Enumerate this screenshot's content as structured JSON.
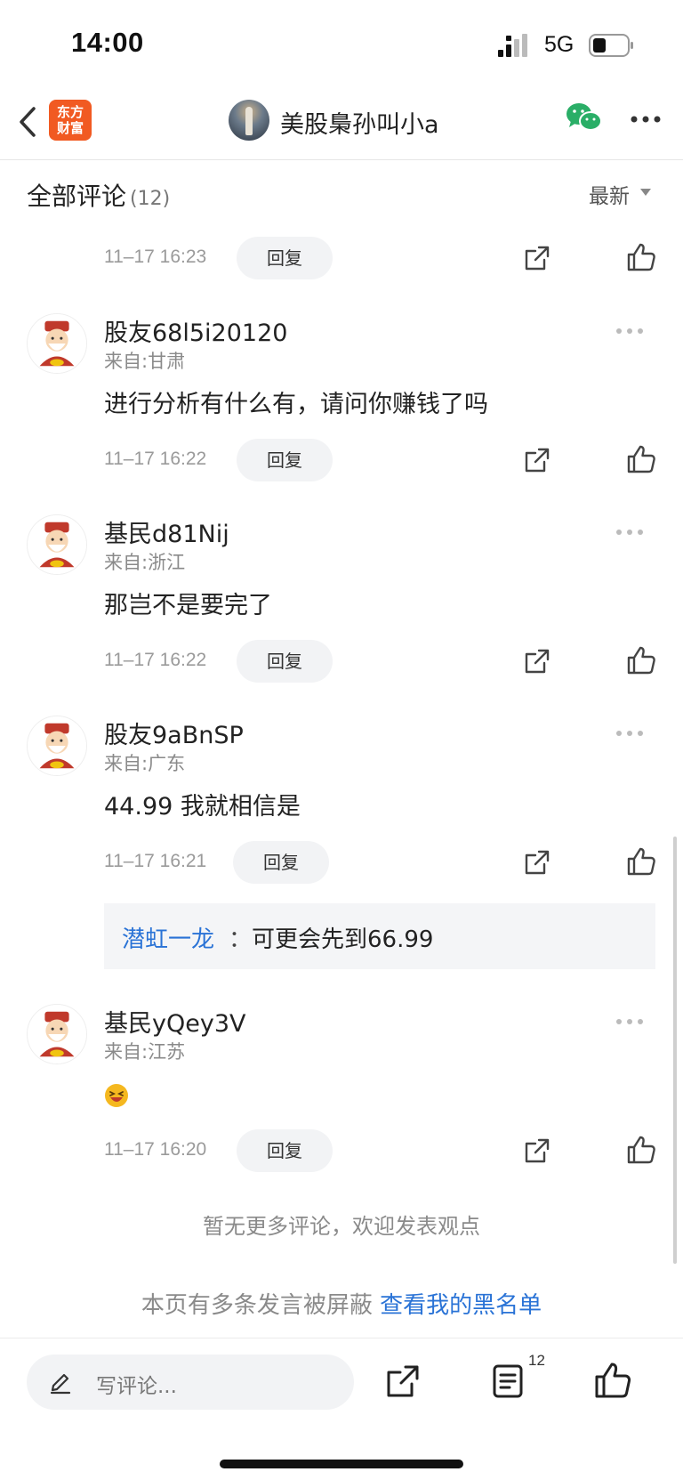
{
  "status_bar": {
    "time": "14:00",
    "network": "5G"
  },
  "nav": {
    "logo_line1": "东方",
    "logo_line2": "财富",
    "author": "美股梟孙叫小a"
  },
  "comments_header": {
    "title": "全部评论",
    "count": "(12)",
    "sort": "最新"
  },
  "comments": [
    {
      "timestamp": "11–17 16:23",
      "reply": "回复"
    },
    {
      "username": "股友68l5i20120",
      "location": "来自:甘肃",
      "text": "进行分析有什么有，请问你赚钱了吗",
      "timestamp": "11–17 16:22",
      "reply": "回复"
    },
    {
      "username": "基民d81Nij",
      "location": "来自:浙江",
      "text": "那岂不是要完了",
      "timestamp": "11–17 16:22",
      "reply": "回复"
    },
    {
      "username": "股友9aBnSP",
      "location": "来自:广东",
      "text": "44.99 我就相信是",
      "timestamp": "11–17 16:21",
      "reply": "回复",
      "sub_reply": {
        "user": "潜虹一龙",
        "colon": "：",
        "text": "可更会先到66.99"
      }
    },
    {
      "username": "基民yQey3V",
      "location": "来自:江苏",
      "emoji": "grinning-squint-emoji",
      "timestamp": "11–17 16:20",
      "reply": "回复"
    }
  ],
  "footer": {
    "no_more": "暂无更多评论，欢迎发表观点",
    "blocked_text": "本页有多条发言被屏蔽 ",
    "blacklist_link": "查看我的黑名单"
  },
  "bottom_bar": {
    "placeholder": "写评论...",
    "comment_count": "12"
  },
  "colors": {
    "brand": "#f15a22",
    "link": "#2a73d6",
    "wechat": "#2aae67"
  }
}
